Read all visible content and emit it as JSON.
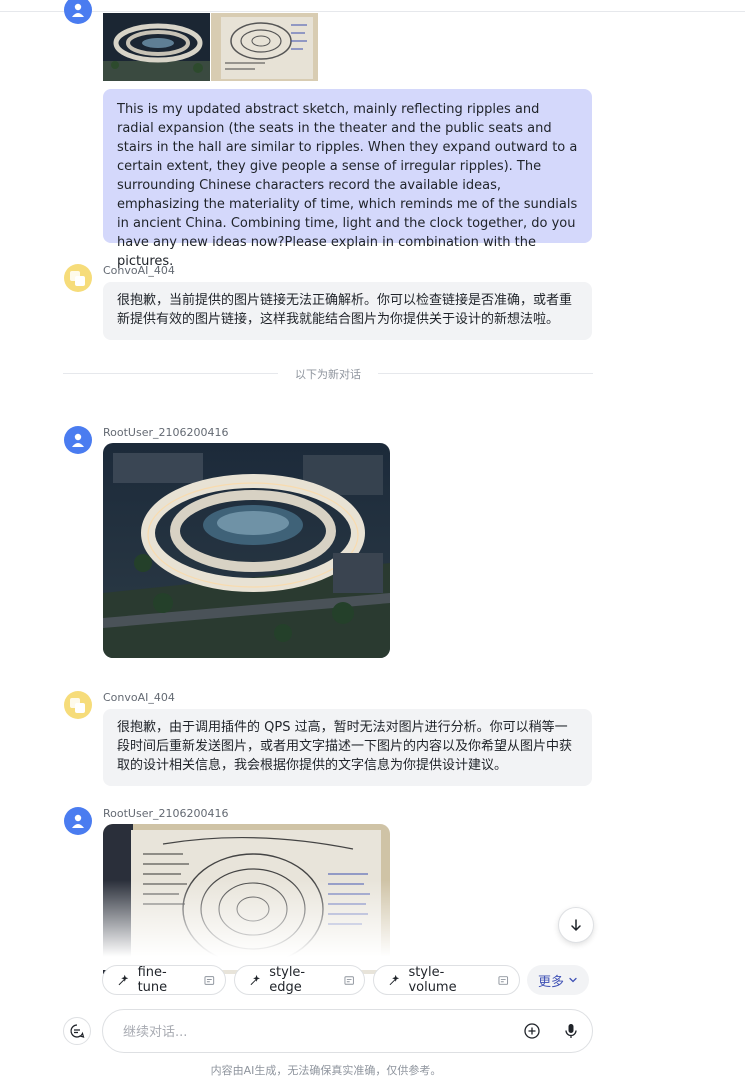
{
  "messages": [
    {
      "role": "user",
      "text": "This is my updated abstract sketch, mainly reflecting ripples and radial expansion (the seats in the theater and the public seats and stairs in the hall are similar to ripples. When they expand outward to a certain extent, they give people a sense of irregular ripples). The surrounding Chinese characters record the available ideas, emphasizing the materiality of time, which reminds me of the sundials in ancient China. Combining time, light and the clock together, do you have any new ideas now?Please explain in combination with the pictures."
    },
    {
      "role": "bot",
      "name": "ConvoAI_404",
      "text": "很抱歉，当前提供的图片链接无法正确解析。你可以检查链接是否准确，或者重新提供有效的图片链接，这样我就能结合图片为你提供关于设计的新想法啦。"
    },
    {
      "role": "user",
      "name": "RootUser_2106200416"
    },
    {
      "role": "bot",
      "name": "ConvoAI_404",
      "text": "很抱歉，由于调用插件的 QPS 过高，暂时无法对图片进行分析。你可以稍等一段时间后重新发送图片，或者用文字描述一下图片的内容以及你希望从图片中获取的设计相关信息，我会根据你提供的文字信息为你提供设计建议。"
    },
    {
      "role": "user",
      "name": "RootUser_2106200416"
    }
  ],
  "divider_label": "以下为新对话",
  "suggestions": [
    {
      "label": "fine-tune"
    },
    {
      "label": "style-edge"
    },
    {
      "label": "style-volume"
    }
  ],
  "more_label": "更多",
  "input": {
    "placeholder": "继续对话..."
  },
  "disclaimer": "内容由AI生成，无法确保真实准确，仅供参考。",
  "colors": {
    "user_bubble": "#d4d8fb",
    "bot_bubble": "#f2f3f5",
    "accent": "#4a7cf0"
  },
  "icons": [
    "person-icon",
    "bot-logo-icon",
    "arrow-down-icon",
    "sparkle-icon",
    "template-icon",
    "chevron-down-icon",
    "new-topic-icon",
    "plus-circle-icon",
    "microphone-icon"
  ]
}
